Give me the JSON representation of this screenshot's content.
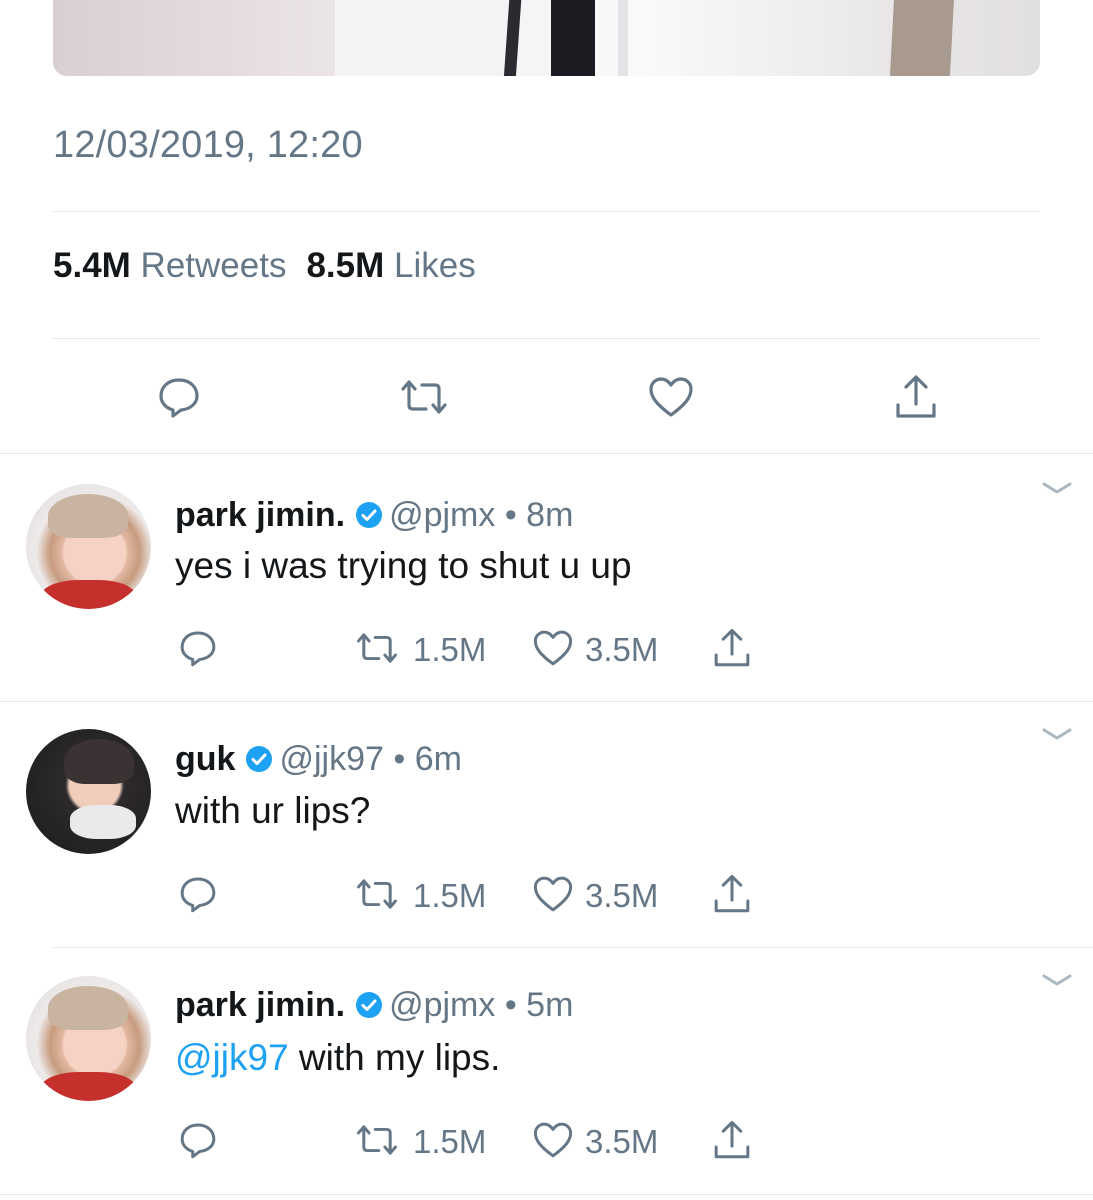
{
  "tweet": {
    "timestamp": "12/03/2019, 12:20",
    "retweets_count": "5.4M",
    "retweets_label": "Retweets",
    "likes_count": "8.5M",
    "likes_label": "Likes",
    "actions": [
      "reply-icon",
      "retweet-icon",
      "like-icon",
      "share-icon"
    ]
  },
  "replies": [
    {
      "name": "park jimin.",
      "handle": "@pjmx",
      "time": "8m",
      "mention": "",
      "text": "yes i was trying to shut u up",
      "retweets": "1.5M",
      "likes": "3.5M"
    },
    {
      "name": "guk",
      "handle": "@jjk97",
      "time": "6m",
      "mention": "",
      "text": "with ur lips?",
      "retweets": "1.5M",
      "likes": "3.5M"
    },
    {
      "name": "park jimin.",
      "handle": "@pjmx",
      "time": "5m",
      "mention": "@jjk97",
      "text": " with my lips.",
      "retweets": "1.5M",
      "likes": "3.5M"
    }
  ],
  "separator": " • ",
  "colors": {
    "link": "#1da1f2",
    "muted": "#657786",
    "text": "#14171a",
    "divider": "#e1e8ed"
  }
}
